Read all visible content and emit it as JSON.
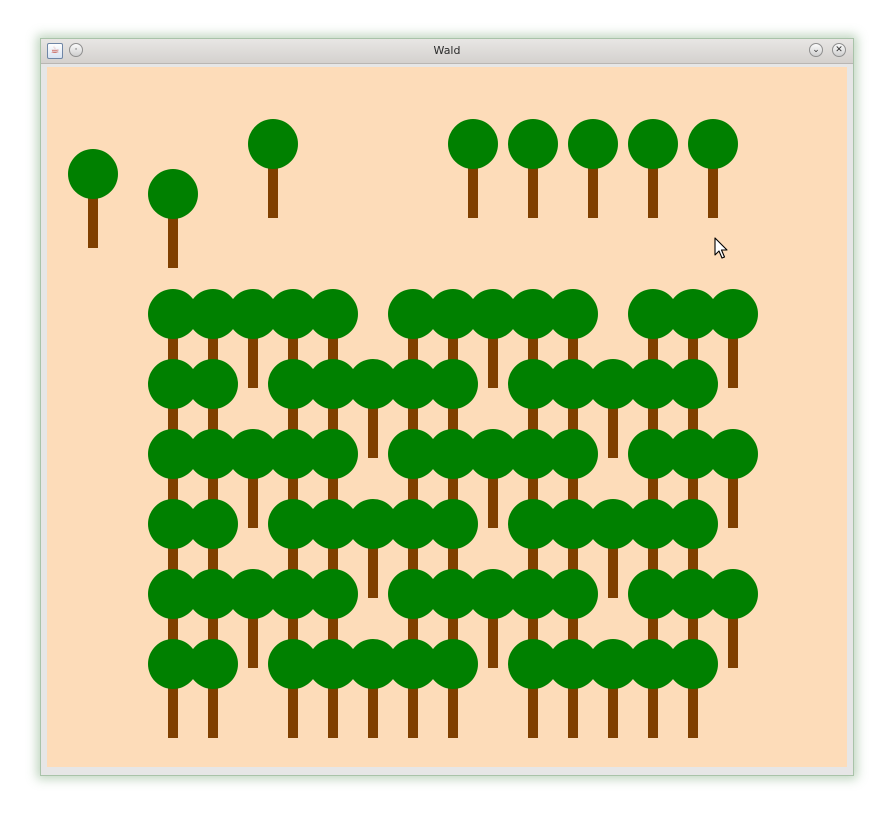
{
  "window": {
    "title": "Wald",
    "buttons": [
      "minimize",
      "maximize",
      "close"
    ]
  },
  "icons": {
    "app": "java-app-icon",
    "menu": "window-menu-icon",
    "minimize": "chevron-down-icon",
    "close": "close-icon",
    "cursor": "mouse-pointer-icon"
  },
  "colors": {
    "background": "#fddcb9",
    "crown": "#008000",
    "trunk": "#804000"
  },
  "scene": {
    "total_trees": 79,
    "loose_trees": 8,
    "forest_rows": 6,
    "forest_columns": 15
  }
}
